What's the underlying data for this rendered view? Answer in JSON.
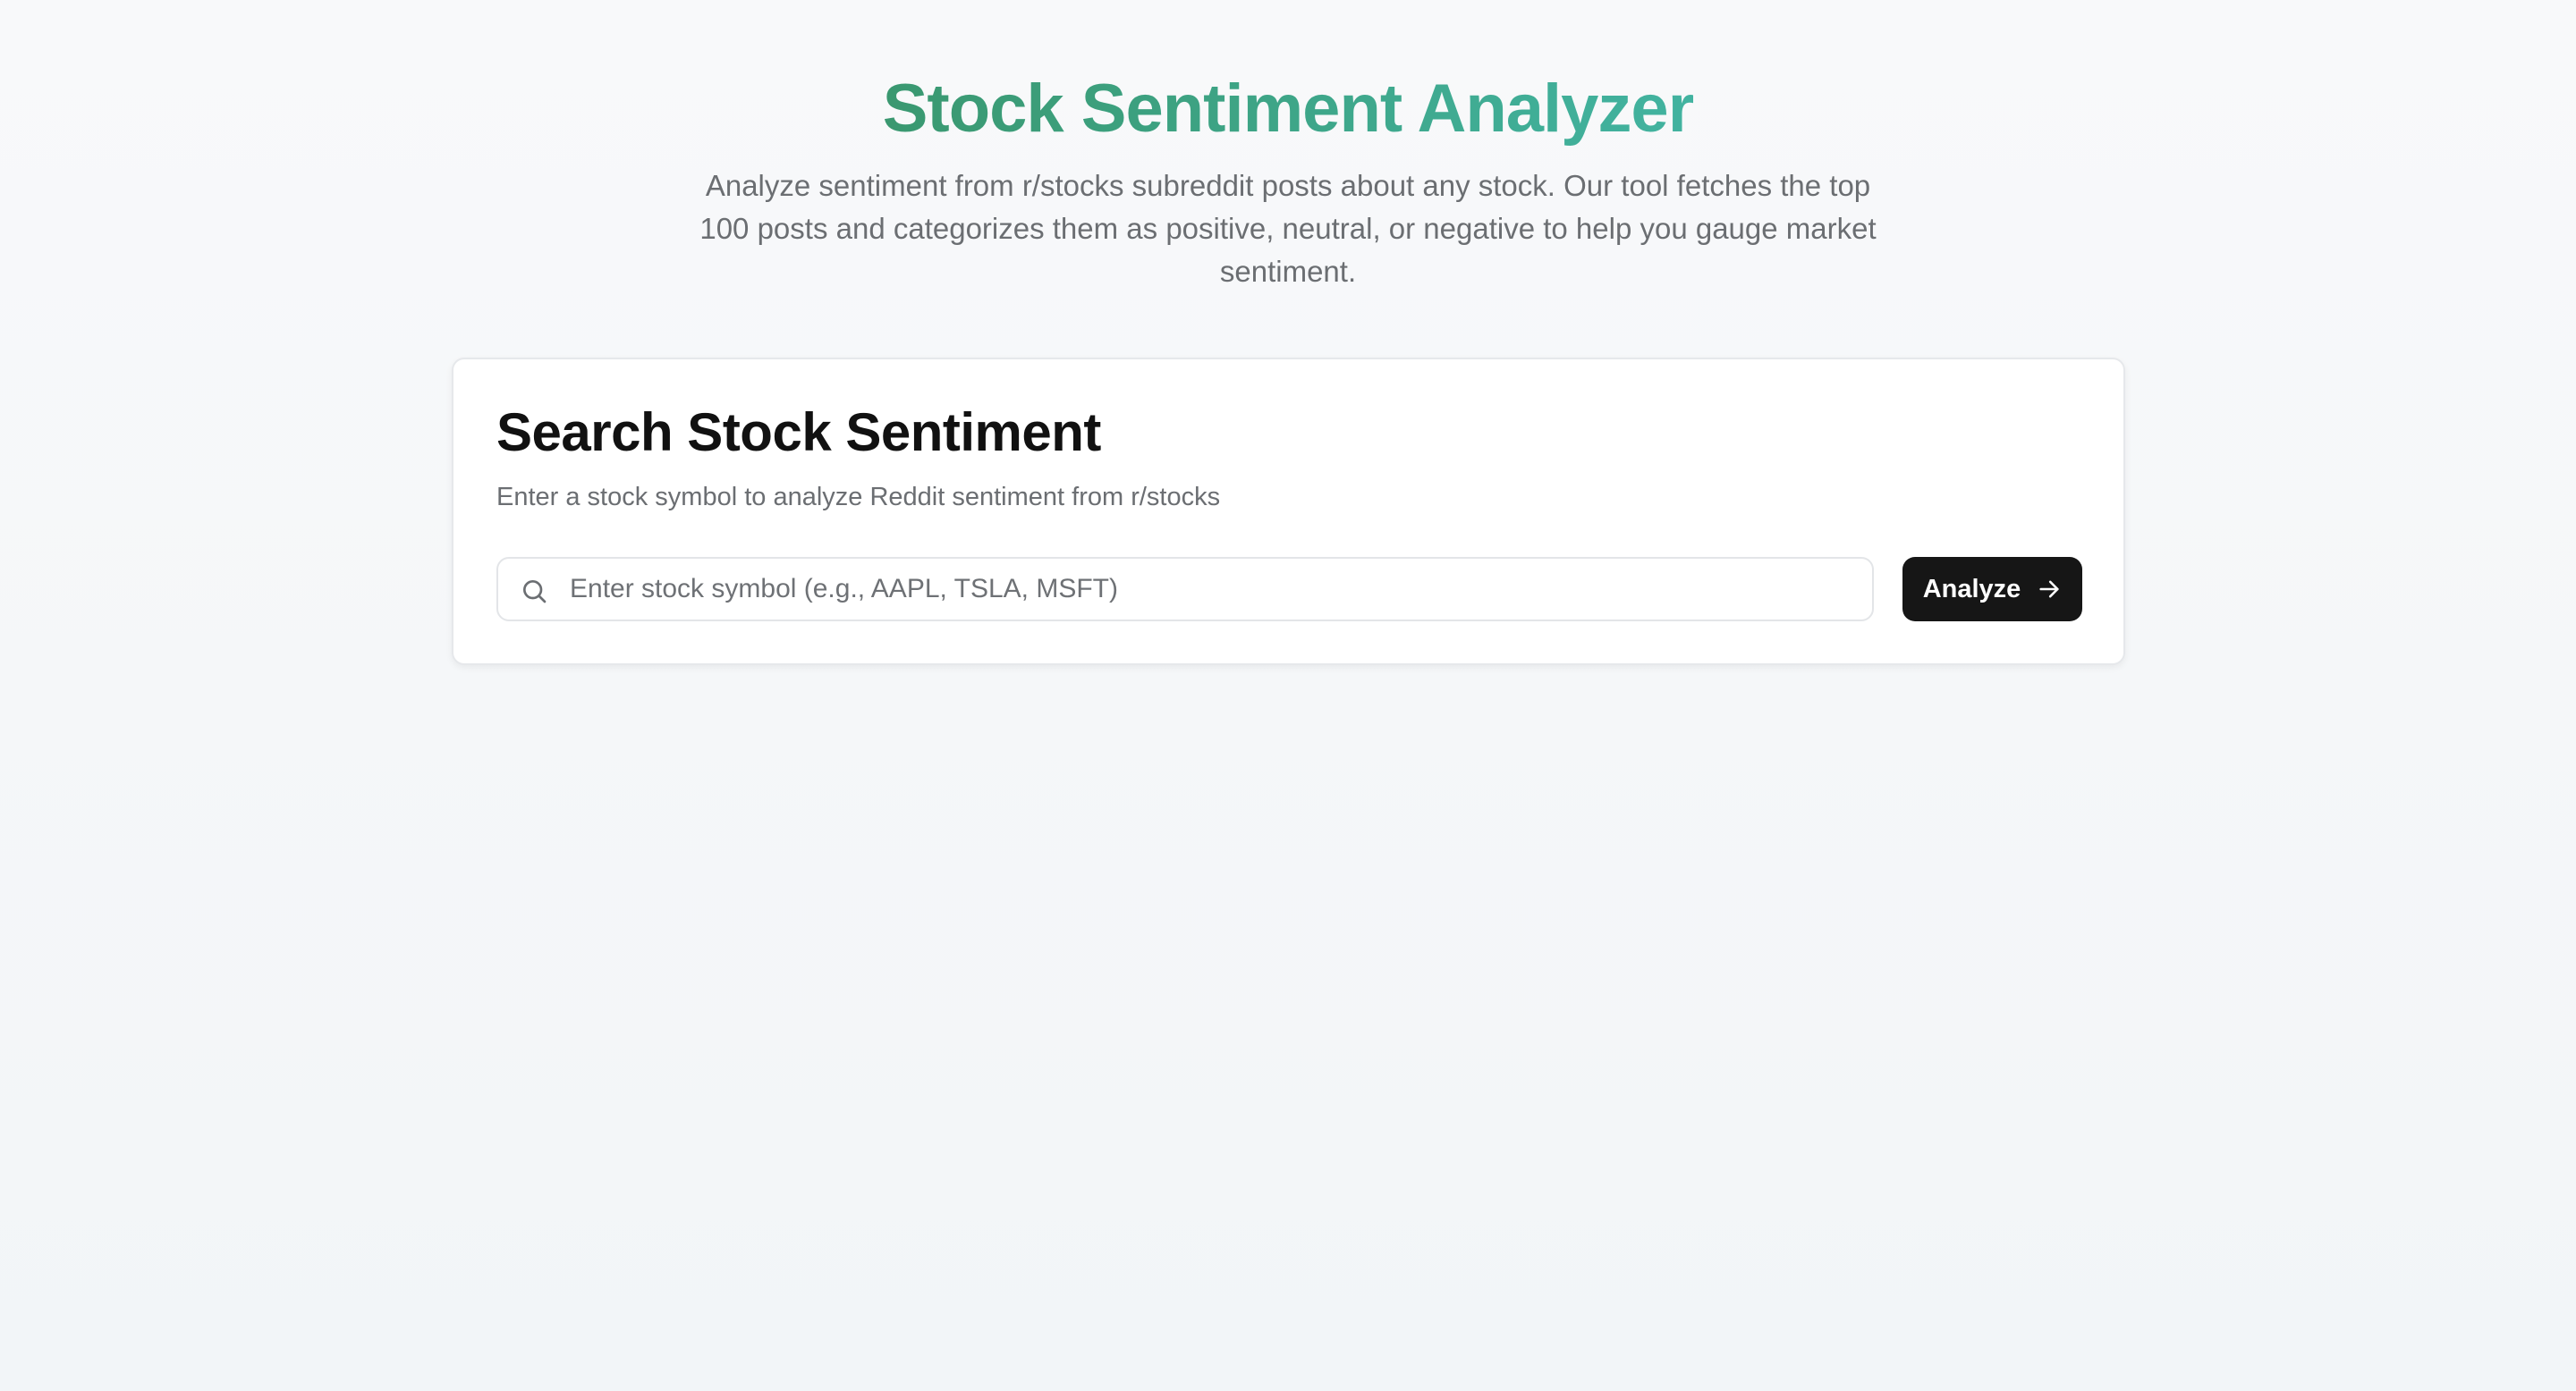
{
  "header": {
    "title": "Stock Sentiment Analyzer",
    "subtitle": "Analyze sentiment from r/stocks subreddit posts about any stock. Our tool fetches the top 100 posts and categorizes them as positive, neutral, or negative to help you gauge market sentiment."
  },
  "search_card": {
    "title": "Search Stock Sentiment",
    "description": "Enter a stock symbol to analyze Reddit sentiment from r/stocks",
    "input": {
      "value": "",
      "placeholder": "Enter stock symbol (e.g., AAPL, TSLA, MSFT)",
      "icon": "search-icon"
    },
    "button": {
      "label": "Analyze",
      "icon": "arrow-right-icon"
    }
  },
  "colors": {
    "title_gradient_start": "#3a9870",
    "title_gradient_end": "#42b3a0",
    "button_bg": "#161616",
    "button_text": "#ffffff",
    "muted_text": "#6b6e72"
  }
}
